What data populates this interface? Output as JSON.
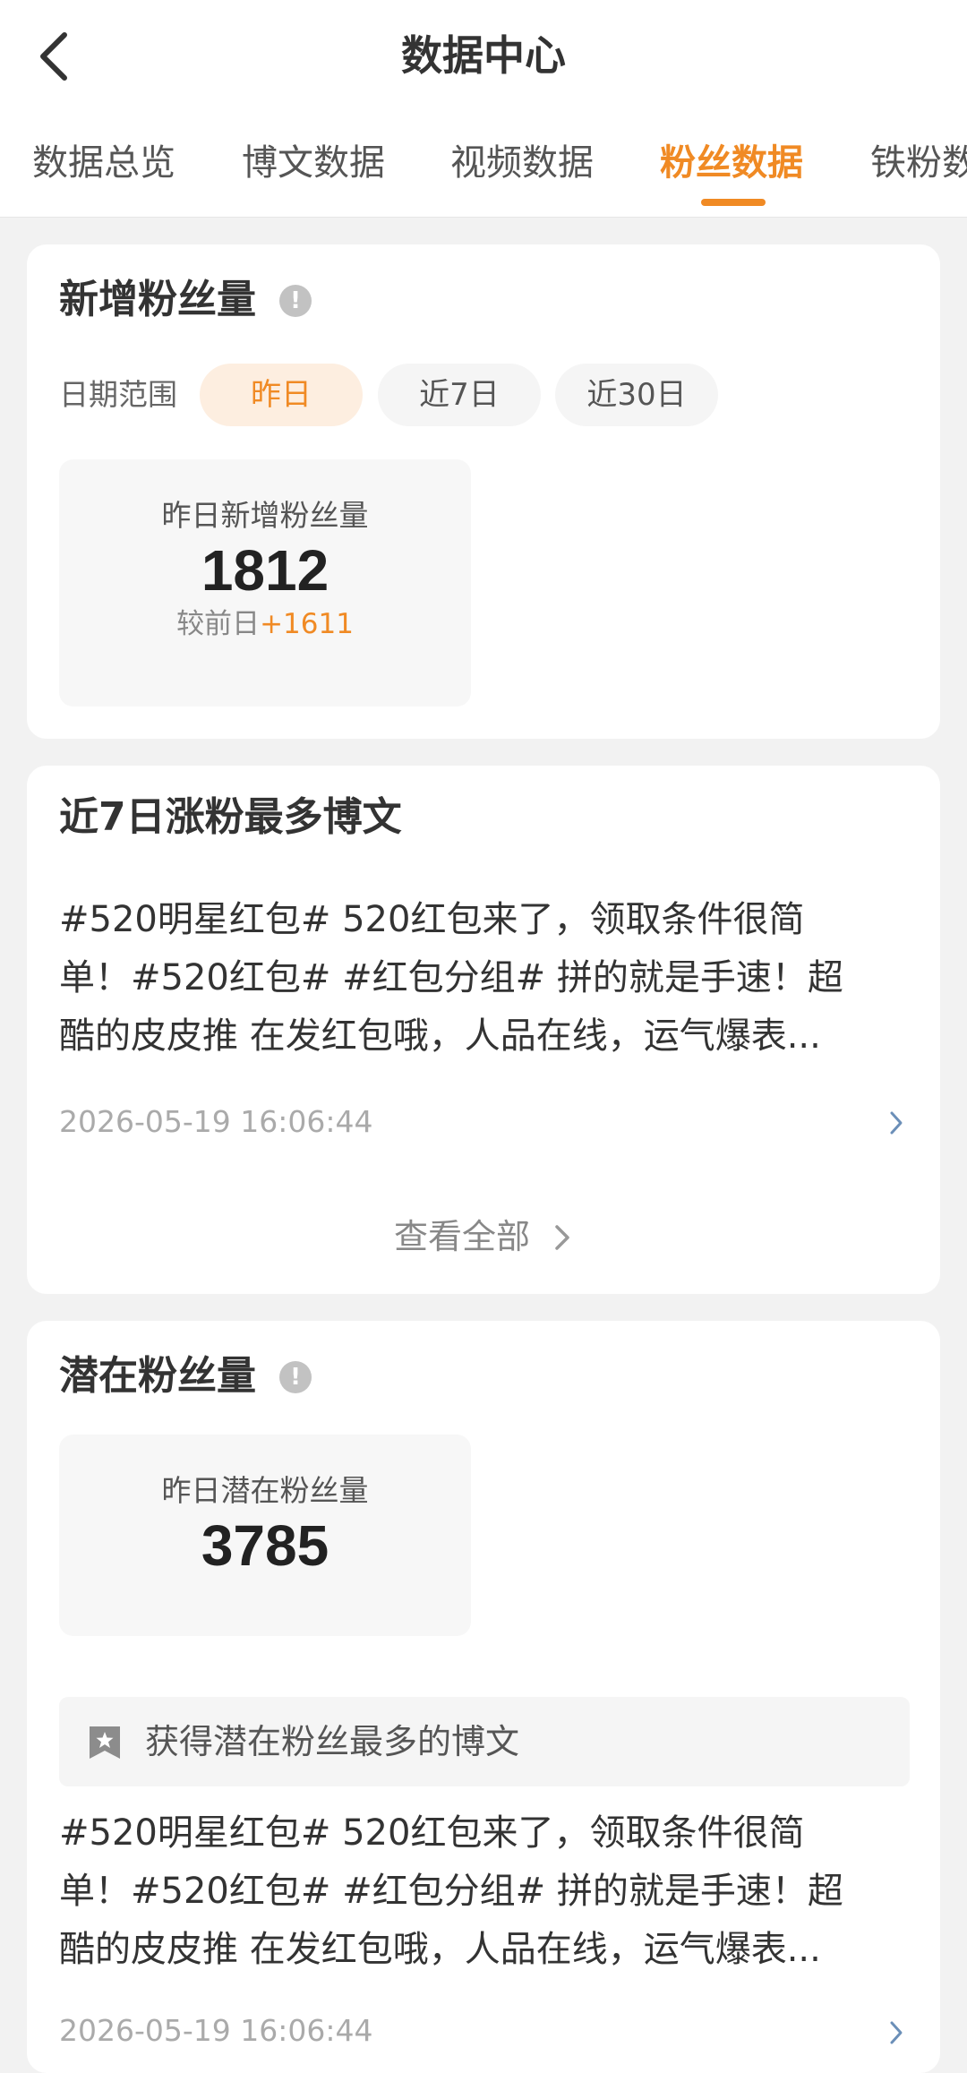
{
  "header": {
    "title": "数据中心",
    "tabs": [
      {
        "label": "数据总览"
      },
      {
        "label": "博文数据"
      },
      {
        "label": "视频数据"
      },
      {
        "label": "粉丝数据"
      },
      {
        "label": "铁粉数"
      }
    ],
    "active_tab": "粉丝数据"
  },
  "new_fans": {
    "title": "新增粉丝量",
    "date_label": "日期范围",
    "ranges": [
      "昨日",
      "近7日",
      "近30日"
    ],
    "selected_range": "昨日",
    "stat_label": "昨日新增粉丝量",
    "stat_value": "1812",
    "compare_label": "较前日",
    "compare_value": "+1611"
  },
  "top_post": {
    "title": "近7日涨粉最多博文",
    "text_lines": [
      "#520明星红包# 520红包来了，领取条件很简",
      "单！#520红包# #红包分组# 拼的就是手速！超",
      "酷的皮皮推 在发红包哦，人品在线，运气爆表..."
    ],
    "time": "2026-05-19 16:06:44",
    "view_all": "查看全部"
  },
  "potential_fans": {
    "title": "潜在粉丝量",
    "stat_label": "昨日潜在粉丝量",
    "stat_value": "3785",
    "banner_text": "获得潜在粉丝最多的博文",
    "text_lines": [
      "#520明星红包# 520红包来了，领取条件很简",
      "单！#520红包# #红包分组# 拼的就是手速！超",
      "酷的皮皮推 在发红包哦，人品在线，运气爆表..."
    ],
    "time": "2026-05-19 16:06:44"
  },
  "colors": {
    "accent": "#f08a24",
    "background": "#f2f2f2",
    "card": "#ffffff"
  },
  "icons": [
    "back-arrow-icon",
    "info-icon",
    "chevron-right-icon",
    "bookmark-star-icon"
  ]
}
